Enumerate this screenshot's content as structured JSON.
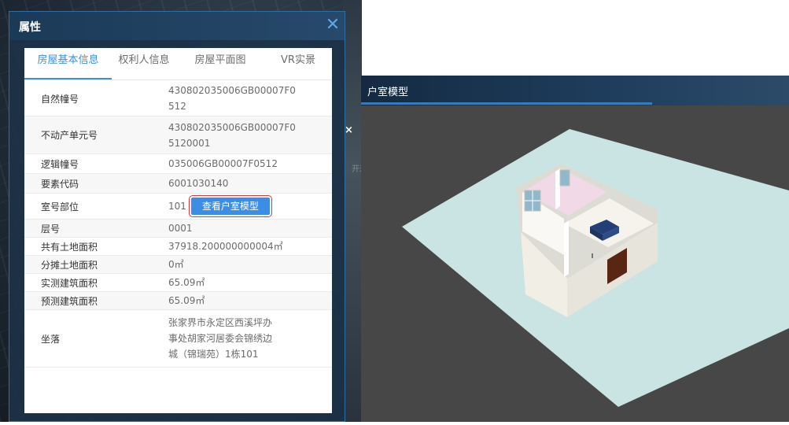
{
  "map": {
    "side_close": "×",
    "side_text": "开米"
  },
  "property_panel": {
    "title": "属性",
    "close": "✕",
    "tabs": [
      {
        "label": "房屋基本信息",
        "active": true
      },
      {
        "label": "权利人信息",
        "active": false
      },
      {
        "label": "房屋平面图",
        "active": false
      },
      {
        "label": "VR实景",
        "active": false
      }
    ],
    "rows": [
      {
        "label": "自然幢号",
        "value": "430802035006GB00007F0\n512"
      },
      {
        "label": "不动产单元号",
        "value": "430802035006GB00007F0\n5120001"
      },
      {
        "label": "逻辑幢号",
        "value": "035006GB00007F0512"
      },
      {
        "label": "要素代码",
        "value": "6001030140"
      },
      {
        "label": "室号部位",
        "value": "101",
        "button": "查看户室模型"
      },
      {
        "label": "层号",
        "value": "0001"
      },
      {
        "label": "共有土地面积",
        "value": "37918.200000000004㎡"
      },
      {
        "label": "分摊土地面积",
        "value": "0㎡"
      },
      {
        "label": "实测建筑面积",
        "value": "65.09㎡"
      },
      {
        "label": "预测建筑面积",
        "value": "65.09㎡"
      },
      {
        "label": "坐落",
        "value": "张家界市永定区西溪坪办\n事处胡家河居委会锦绣边\n城（锦瑞苑）1栋101"
      }
    ]
  },
  "model_panel": {
    "title": "户室模型"
  },
  "colors": {
    "accent": "#3b8de6",
    "ground": "#c9e4e2",
    "wall": "#f4f1ea",
    "sofa": "#2e4b86",
    "door": "#5a2614"
  }
}
